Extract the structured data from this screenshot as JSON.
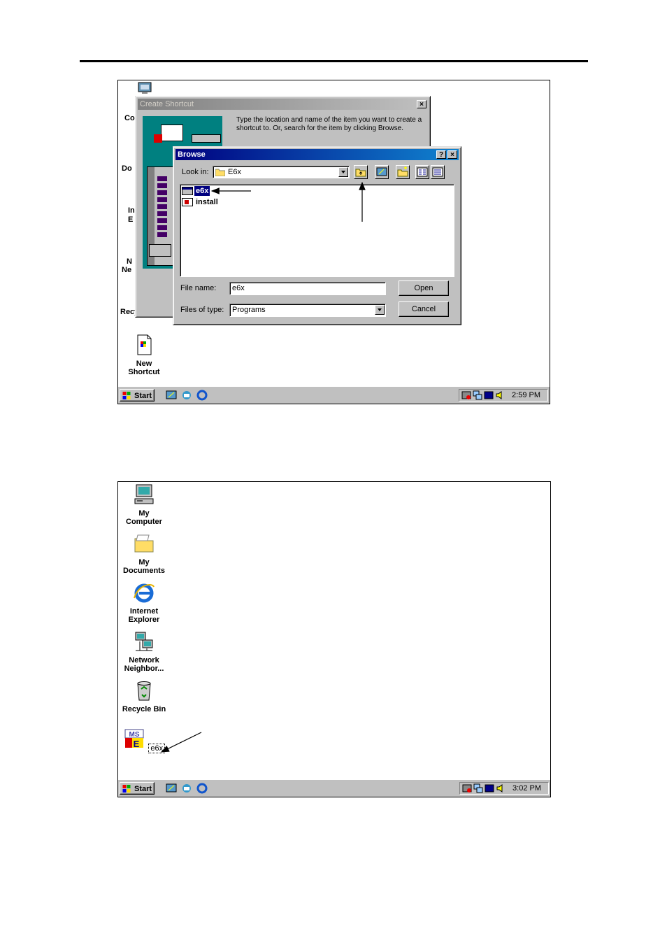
{
  "screenshot1": {
    "create_shortcut": {
      "title": "Create Shortcut",
      "close": "×",
      "instructions": "Type the location and name of the item you want to create a shortcut to. Or, search for the item by clicking Browse."
    },
    "browse": {
      "title": "Browse",
      "help": "?",
      "close": "×",
      "look_in_label": "Look in:",
      "look_in_value": "E6x",
      "files": [
        "e6x",
        "install"
      ],
      "file_name_label": "File name:",
      "file_name_value": "e6x",
      "files_of_type_label": "Files of type:",
      "files_of_type_value": "Programs",
      "open_label": "Open",
      "cancel_label": "Cancel"
    },
    "desktop_partial": [
      "Co",
      "Do",
      "In",
      "E",
      "N",
      "Ne",
      "Recycle Bin"
    ],
    "new_shortcut_label": [
      "New",
      "Shortcut"
    ],
    "taskbar": {
      "start": "Start",
      "clock": "2:59 PM"
    }
  },
  "screenshot2": {
    "desktop_icons": [
      {
        "line1": "My",
        "line2": "Computer",
        "icon": "computer-icon"
      },
      {
        "line1": "My",
        "line2": "Documents",
        "icon": "folder-icon"
      },
      {
        "line1": "Internet",
        "line2": "Explorer",
        "icon": "ie-icon"
      },
      {
        "line1": "Network",
        "line2": "Neighbor...",
        "icon": "network-icon"
      },
      {
        "line1": "Recycle Bin",
        "line2": "",
        "icon": "recycle-bin-icon"
      },
      {
        "line1": "e6x",
        "line2": "",
        "icon": "e6x-shortcut-icon"
      }
    ],
    "taskbar": {
      "start": "Start",
      "clock": "3:02 PM"
    }
  },
  "colors": {
    "title_active": "#000080",
    "desktop": "#ffffff",
    "chrome": "#c0c0c0"
  }
}
